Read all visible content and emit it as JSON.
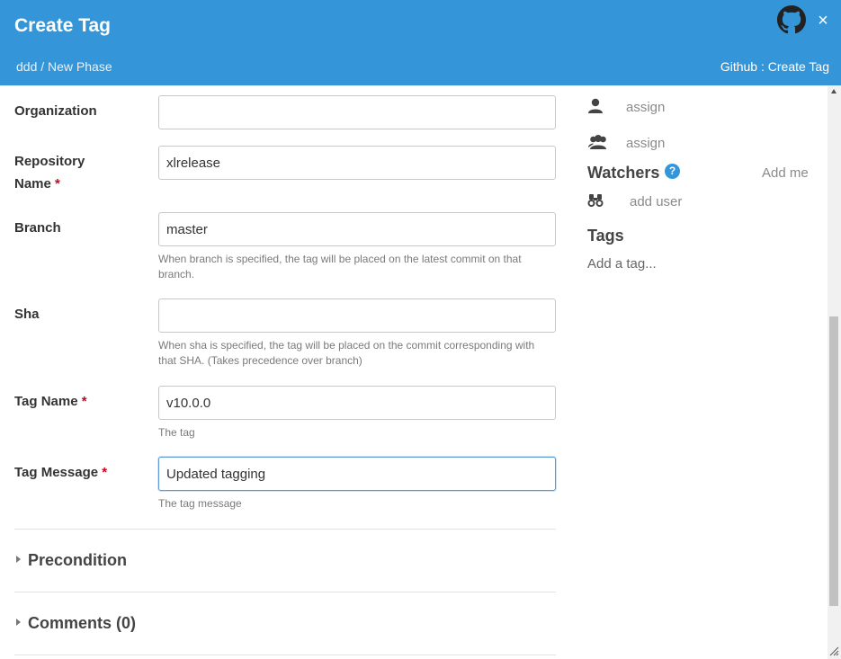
{
  "header": {
    "title": "Create Tag",
    "breadcrumb": "ddd / New Phase",
    "task_type": "Github : Create Tag",
    "accent_color": "#3496d8",
    "close_symbol": "×"
  },
  "form": {
    "organization": {
      "label": "Organization",
      "value": ""
    },
    "repository_name": {
      "label_line1": "Repository",
      "label_line2": "Name",
      "required": "*",
      "value": "xlrelease"
    },
    "branch": {
      "label": "Branch",
      "value": "master",
      "hint": "When branch is specified, the tag will be placed on the latest commit on that branch."
    },
    "sha": {
      "label": "Sha",
      "value": "",
      "hint": "When sha is specified, the tag will be placed on the commit corresponding with that SHA. (Takes precedence over branch)"
    },
    "tag_name": {
      "label": "Tag Name",
      "required": "*",
      "value": "v10.0.0",
      "hint": "The tag"
    },
    "tag_message": {
      "label": "Tag Message",
      "required": "*",
      "value": "Updated tagging",
      "hint": "The tag message"
    }
  },
  "sections": {
    "precondition": "Precondition",
    "comments": "Comments (0)"
  },
  "sidebar": {
    "owner_assign": "assign",
    "team_assign": "assign",
    "watchers_title": "Watchers",
    "help_symbol": "?",
    "add_me": "Add me",
    "add_user": "add user",
    "tags_title": "Tags",
    "add_tag": "Add a tag..."
  }
}
